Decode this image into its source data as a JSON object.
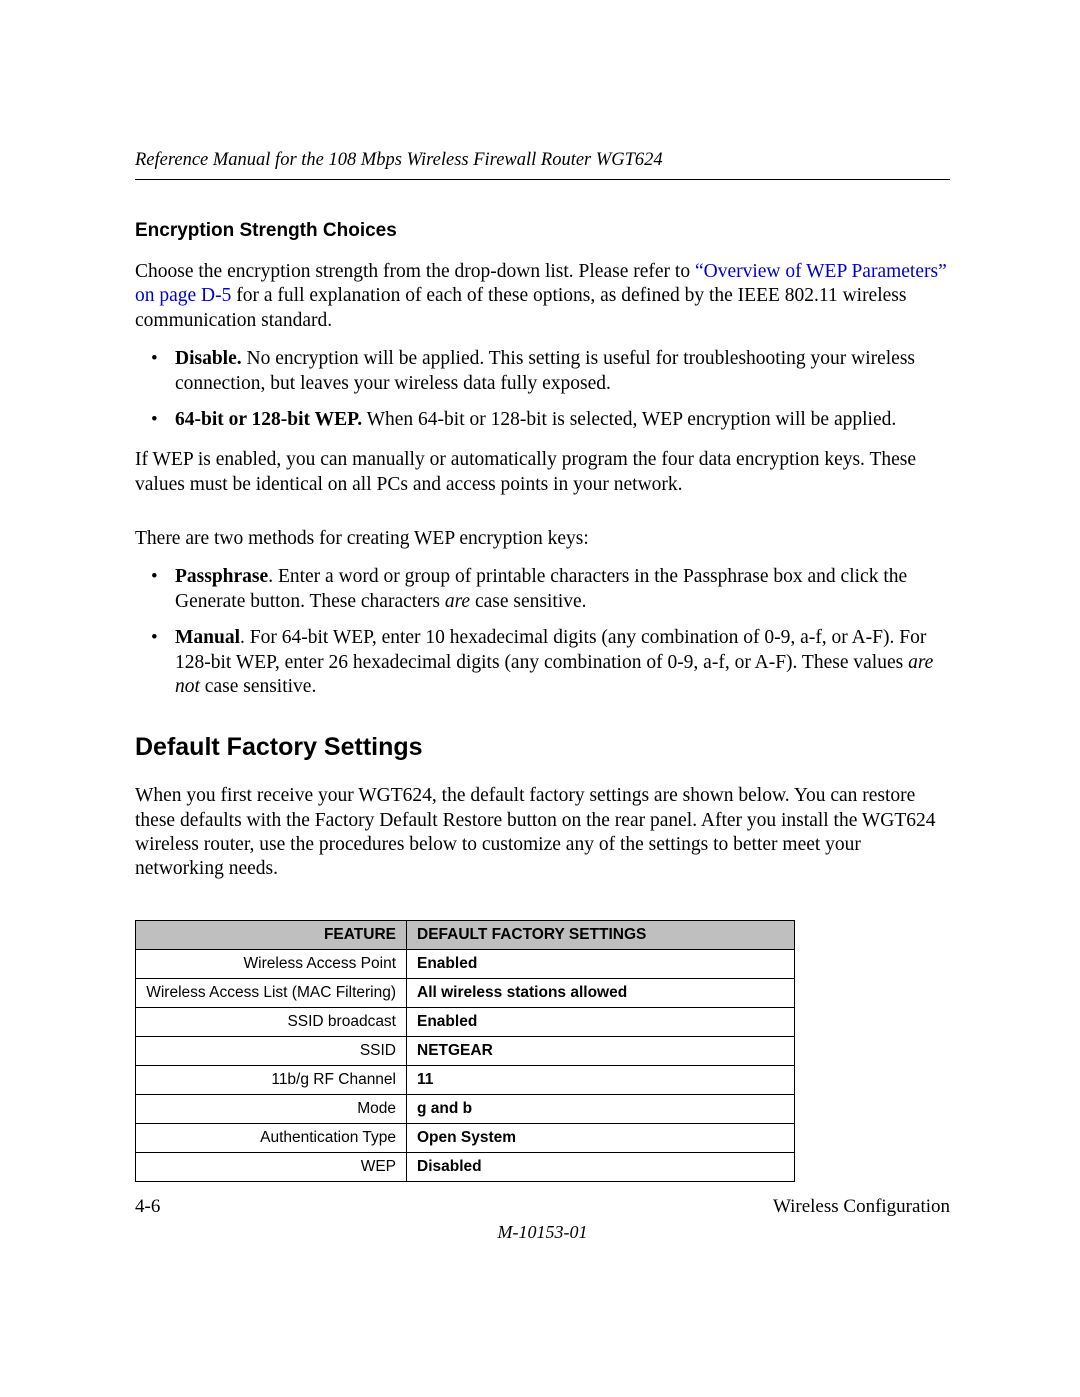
{
  "header": {
    "running_title": "Reference Manual for the 108 Mbps Wireless Firewall Router WGT624"
  },
  "sections": {
    "enc_head": "Encryption Strength Choices",
    "enc_p1_a": "Choose the encryption strength from the drop-down list. Please refer to ",
    "enc_p1_link": "“Overview of WEP Parameters” on page D-5",
    "enc_p1_b": " for a full explanation of each of these options, as defined by the IEEE 802.11 wireless communication standard.",
    "bul1_bold": "Disable.",
    "bul1_rest": " No encryption will be applied. This setting is useful for troubleshooting your wireless connection, but leaves your wireless data fully exposed.",
    "bul2_bold": "64-bit or 128-bit WEP.",
    "bul2_rest": " When 64-bit or 128-bit is selected, WEP encryption will be applied.",
    "p_after1": "If WEP is enabled, you can manually or automatically program the four data encryption keys. These values must be identical on all PCs and access points in your network.",
    "p_after2": "There are two methods for creating WEP encryption keys:",
    "bul3_bold": "Passphrase",
    "bul3_rest_a": ". Enter a word or group of printable characters in the Passphrase box and click the Generate button. These characters ",
    "bul3_it": "are",
    "bul3_rest_b": " case sensitive.",
    "bul4_bold": "Manual",
    "bul4_rest_a": ". For 64-bit WEP, enter 10 hexadecimal digits (any combination of 0-9, a-f, or A-F). For 128-bit WEP, enter 26 hexadecimal digits (any combination of 0-9, a-f, or A-F). These values ",
    "bul4_it": "are not",
    "bul4_rest_b": " case sensitive.",
    "dfs_head": "Default Factory Settings",
    "dfs_p": "When you first receive your WGT624, the default factory settings are shown below. You can restore these defaults with the Factory Default Restore button on the rear panel. After you install the WGT624 wireless router, use the procedures below to customize any of the settings to better meet your networking needs."
  },
  "table": {
    "head_feature": "FEATURE",
    "head_default": "DEFAULT FACTORY SETTINGS",
    "rows": [
      {
        "feature": "Wireless Access Point",
        "value": "Enabled"
      },
      {
        "feature": "Wireless Access List (MAC Filtering)",
        "value": "All wireless stations allowed"
      },
      {
        "feature": "SSID broadcast",
        "value": "Enabled"
      },
      {
        "feature": "SSID",
        "value": "NETGEAR"
      },
      {
        "feature": "11b/g RF Channel",
        "value": "11"
      },
      {
        "feature": "Mode",
        "value": "g and b"
      },
      {
        "feature": "Authentication Type",
        "value": "Open System"
      },
      {
        "feature": "WEP",
        "value": "Disabled"
      }
    ]
  },
  "footer": {
    "page_num": "4-6",
    "section": "Wireless Configuration",
    "docid": "M-10153-01"
  }
}
